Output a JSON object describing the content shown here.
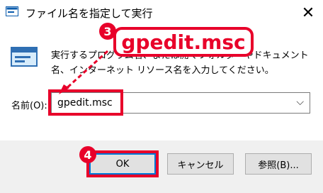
{
  "window": {
    "title": "ファイル名を指定して実行",
    "close_glyph": "✕"
  },
  "dialog": {
    "description": "実行するプログラム名、または開くフォルダーやドキュメント名、インターネット リソース名を入力してください。",
    "open_label": "名前(O):",
    "open_value": "gpedit.msc",
    "dropdown_glyph": "⌵"
  },
  "buttons": {
    "ok": "OK",
    "cancel": "キャンセル",
    "browse": "参照(B)..."
  },
  "annotations": {
    "step3_number": "3",
    "step3_text": "gpedit.msc",
    "step4_number": "4"
  },
  "colors": {
    "accent_red": "#e8002a",
    "focus_blue": "#0078d7"
  }
}
